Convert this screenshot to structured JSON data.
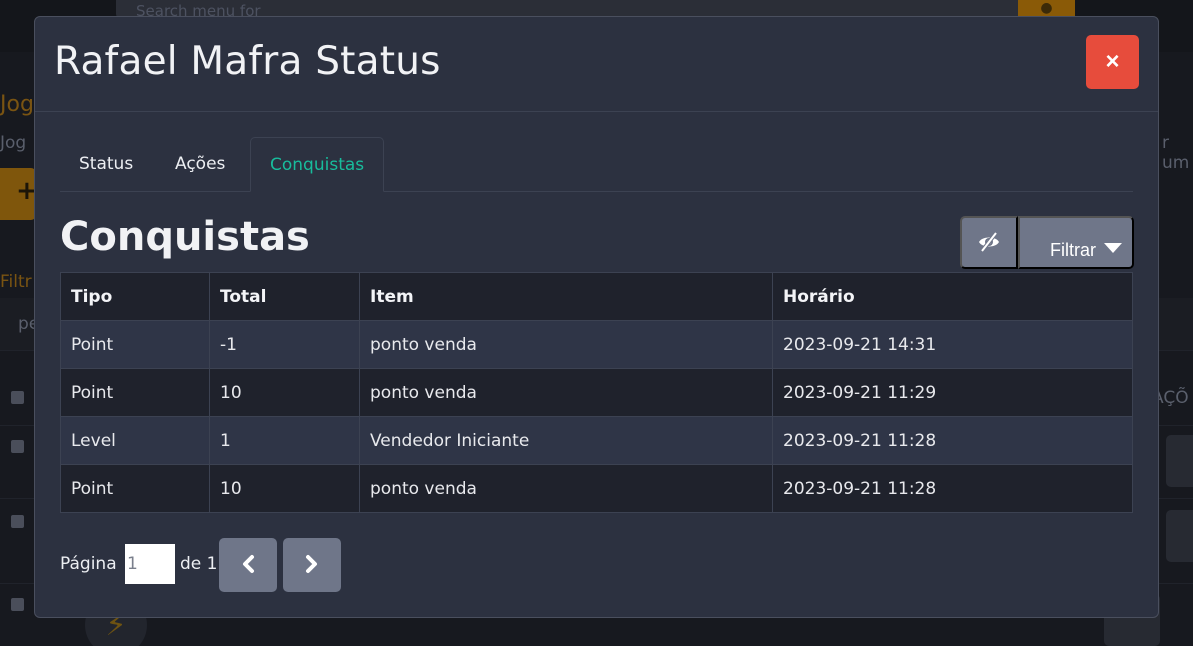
{
  "background": {
    "search_placeholder": "Search menu for",
    "fragments": [
      "Jog",
      "Jog",
      "Filtr",
      "pe",
      "r um",
      "AÇÕ"
    ]
  },
  "modal": {
    "title": "Rafael Mafra Status",
    "close_label": "×",
    "tabs": [
      {
        "label": "Status",
        "active": false
      },
      {
        "label": "Ações",
        "active": false
      },
      {
        "label": "Conquistas",
        "active": true
      }
    ],
    "section_title": "Conquistas",
    "toolbar": {
      "visibility_icon": "eye-slash-icon",
      "filter_label": "Filtrar"
    },
    "table": {
      "headers": [
        "Tipo",
        "Total",
        "Item",
        "Horário"
      ],
      "rows": [
        [
          "Point",
          "-1",
          "ponto venda",
          "2023-09-21 14:31"
        ],
        [
          "Point",
          "10",
          "ponto venda",
          "2023-09-21 11:29"
        ],
        [
          "Level",
          "1",
          "Vendedor Iniciante",
          "2023-09-21 11:28"
        ],
        [
          "Point",
          "10",
          "ponto venda",
          "2023-09-21 11:28"
        ]
      ]
    },
    "pagination": {
      "page_label": "Página",
      "current_page": "1",
      "of_label": "de 1",
      "prev_icon": "chevron-left-icon",
      "next_icon": "chevron-right-icon"
    }
  },
  "colors": {
    "modal_bg": "#2c3140",
    "active_tab": "#18bc9c",
    "close_button": "#e74c3c",
    "secondary_button": "#6f7689"
  }
}
